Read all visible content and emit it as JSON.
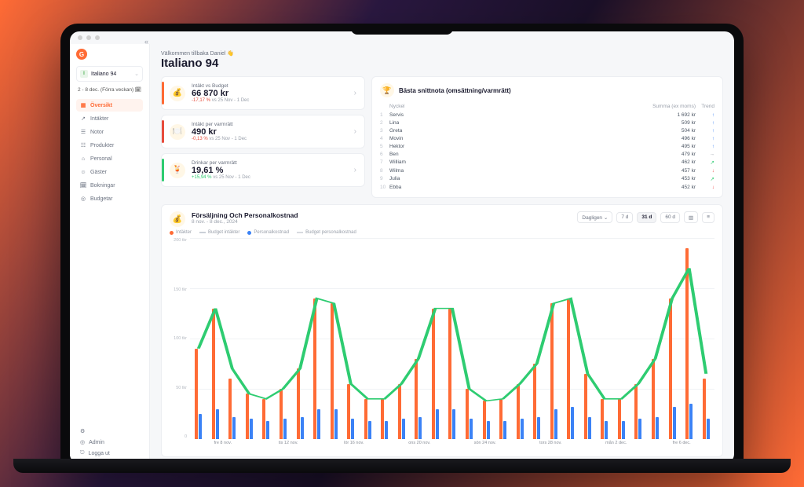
{
  "brand_letter": "G",
  "restaurant": {
    "badge": "I",
    "name": "Italiano 94"
  },
  "date_range": "2 - 8 dec. (Förra veckan)",
  "nav": {
    "overview": "Översikt",
    "income": "Intäkter",
    "notes": "Notor",
    "products": "Produkter",
    "personnel": "Personal",
    "guests": "Gäster",
    "bookings": "Bokningar",
    "budgets": "Budgetar"
  },
  "bottom_nav": {
    "admin": "Admin",
    "logout": "Logga ut"
  },
  "welcome": "Välkommen tillbaka Daniel 👋",
  "page_title": "Italiano 94",
  "kpis": [
    {
      "label": "Intäkt vs Budget",
      "value": "66 870 kr",
      "delta": "-17,17 %",
      "period": "vs 25 Nov - 1 Dec",
      "dir": "down",
      "accent": "orange",
      "icon": "💰"
    },
    {
      "label": "Intäkt per varmrätt",
      "value": "490 kr",
      "delta": "-0,13 %",
      "period": "vs 25 Nov - 1 Dec",
      "dir": "down",
      "accent": "red",
      "icon": "🍽️"
    },
    {
      "label": "Drinkar per varmrätt",
      "value": "19,61 %",
      "delta": "+15,94 %",
      "period": "vs 25 Nov - 1 Dec",
      "dir": "up",
      "accent": "green",
      "icon": "🍹"
    }
  ],
  "table": {
    "title": "Bästa snittnota (omsättning/varmrätt)",
    "columns": {
      "key": "Nyckel",
      "sum": "Summa (ex moms)",
      "trend": "Trend"
    },
    "rows": [
      {
        "rank": 1,
        "name": "Servis",
        "sum": "1 692 kr",
        "trend": "up"
      },
      {
        "rank": 2,
        "name": "Lina",
        "sum": "509 kr",
        "trend": "up"
      },
      {
        "rank": 3,
        "name": "Greta",
        "sum": "504 kr",
        "trend": "up"
      },
      {
        "rank": 4,
        "name": "Movin",
        "sum": "496 kr",
        "trend": "up"
      },
      {
        "rank": 5,
        "name": "Hektor",
        "sum": "495 kr",
        "trend": "up"
      },
      {
        "rank": 6,
        "name": "Ben",
        "sum": "479 kr",
        "trend": "right"
      },
      {
        "rank": 7,
        "name": "William",
        "sum": "462 kr",
        "trend": "diag"
      },
      {
        "rank": 8,
        "name": "Wilma",
        "sum": "457 kr",
        "trend": "down"
      },
      {
        "rank": 9,
        "name": "Julia",
        "sum": "453 kr",
        "trend": "diag"
      },
      {
        "rank": 10,
        "name": "Ebba",
        "sum": "452 kr",
        "trend": "down"
      }
    ]
  },
  "chart": {
    "title": "Försäljning Och Personalkostnad",
    "subtitle": "8 nov. - 8 dec., 2024",
    "period_selector": "Dagligen",
    "range_buttons": {
      "d7": "7 d",
      "d31": "31 d",
      "d60": "60 d"
    },
    "legend": {
      "income": "Intäkter",
      "budget_income": "Budget intäkter",
      "staff_cost": "Personalkostnad",
      "budget_staff": "Budget personalkostnad"
    }
  },
  "chart_data": {
    "type": "bar",
    "ylim": [
      0,
      200
    ],
    "ylabel": "tkr",
    "yticks": [
      "200 tkr",
      "150 tkr",
      "100 tkr",
      "50 tkr",
      "0"
    ],
    "xticks": [
      "fre 8 nov.",
      "tis 12 nov.",
      "lör 16 nov.",
      "ons 20 nov.",
      "sön 24 nov.",
      "tors 28 nov.",
      "mån 2 dec.",
      "fre 6 dec."
    ],
    "series": [
      {
        "name": "Intäkter",
        "color": "#ff6b35",
        "values": [
          90,
          130,
          60,
          45,
          40,
          50,
          70,
          140,
          135,
          55,
          40,
          40,
          55,
          80,
          130,
          130,
          50,
          38,
          40,
          55,
          75,
          135,
          140,
          65,
          40,
          40,
          55,
          80,
          140,
          190,
          60
        ]
      },
      {
        "name": "Personalkostnad",
        "color": "#3b82f6",
        "values": [
          25,
          30,
          22,
          20,
          18,
          20,
          22,
          30,
          30,
          20,
          18,
          18,
          20,
          22,
          30,
          30,
          20,
          18,
          18,
          20,
          22,
          30,
          32,
          22,
          18,
          18,
          20,
          22,
          32,
          35,
          20
        ]
      },
      {
        "name": "Budget intäkter",
        "color": "#2ecc71",
        "type": "line",
        "values": [
          90,
          130,
          70,
          45,
          40,
          50,
          70,
          140,
          135,
          55,
          40,
          40,
          55,
          80,
          130,
          130,
          50,
          38,
          40,
          55,
          75,
          135,
          140,
          65,
          40,
          40,
          55,
          80,
          140,
          170,
          65
        ]
      }
    ]
  }
}
